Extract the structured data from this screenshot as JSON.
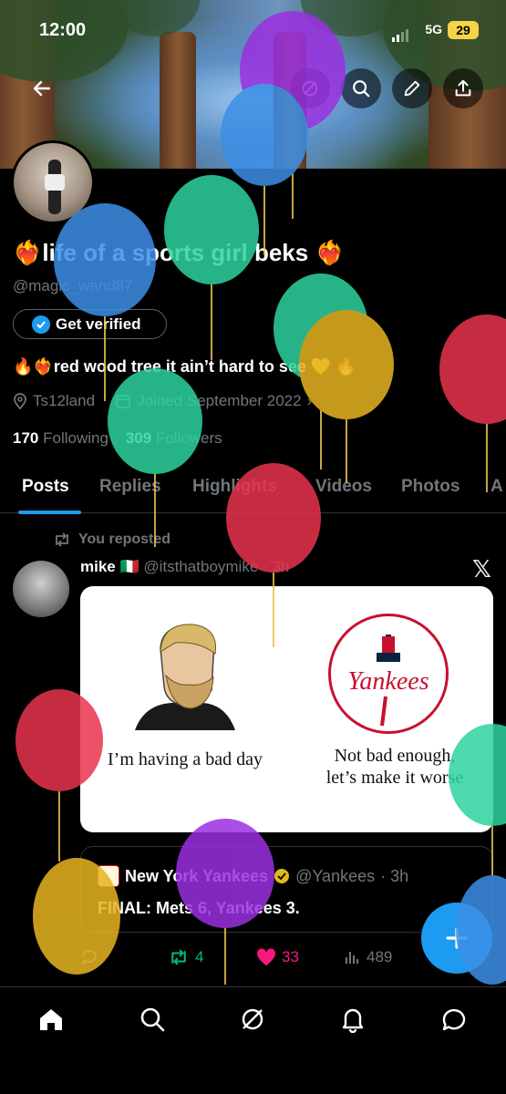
{
  "status_bar": {
    "time": "12:00",
    "network": "5G",
    "battery": "29"
  },
  "profile": {
    "display_name": "❤️‍🔥life of a sports girl beks ❤️‍🔥",
    "handle": "@magic_wand87",
    "get_verified_label": "Get verified",
    "bio": "🔥❤️‍🔥red wood tree it ain’t hard to see 💛 🔥",
    "location": "Ts12land",
    "joined": "Joined September 2022",
    "following_count": "170",
    "following_label": "Following",
    "followers_count": "309",
    "followers_label": "Followers"
  },
  "tabs": [
    {
      "label": "Posts"
    },
    {
      "label": "Replies"
    },
    {
      "label": "Highlights"
    },
    {
      "label": "Videos"
    },
    {
      "label": "Photos"
    },
    {
      "label": "A"
    }
  ],
  "post": {
    "repost_label": "You reposted",
    "author_name": "mike 🇮🇹",
    "author_handle": "@itsthatboymike",
    "time": "· 3h",
    "meme_left_caption": "I’m having a bad day",
    "meme_right_caption_1": "Not bad enough,",
    "meme_right_caption_2": "let’s make it worse",
    "quote": {
      "author_name": "New York Yankees",
      "author_handle": "@Yankees",
      "time": "· 3h",
      "text": "FINAL: Mets 6, Yankees 3."
    },
    "reposts": "4",
    "likes": "33",
    "views": "489"
  },
  "colors": {
    "accent": "#1d9bf0",
    "repost_green": "#00ba7c",
    "like_pink": "#f91880",
    "muted": "#71767b"
  },
  "icons": {
    "back": "back-arrow-icon",
    "search": "search-icon",
    "edit": "pencil-icon",
    "share": "share-icon",
    "verified": "verified-check-icon",
    "nav": [
      "home-icon",
      "search-icon",
      "grok-icon",
      "notifications-icon",
      "messages-icon"
    ]
  }
}
